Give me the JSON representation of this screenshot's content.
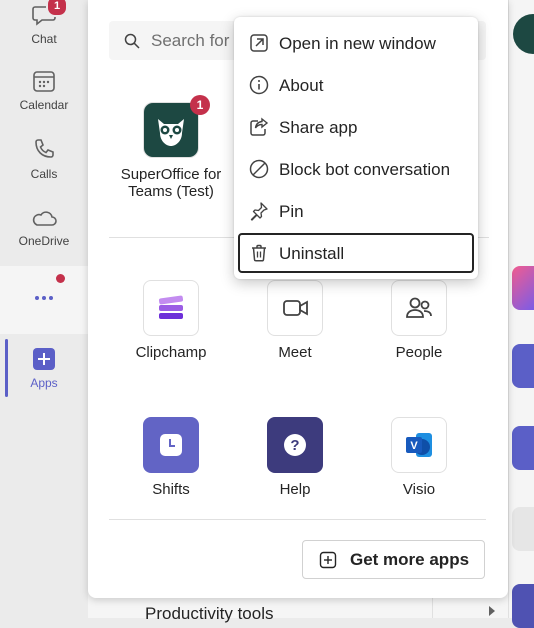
{
  "rail": {
    "items": [
      {
        "label": "Chat",
        "icon": "chat-icon",
        "badge": "1"
      },
      {
        "label": "Calendar",
        "icon": "calendar-icon"
      },
      {
        "label": "Calls",
        "icon": "calls-icon"
      },
      {
        "label": "OneDrive",
        "icon": "onedrive-icon"
      },
      {
        "label": "",
        "icon": "more-icon"
      },
      {
        "label": "Apps",
        "icon": "apps-icon"
      }
    ]
  },
  "search": {
    "placeholder": "Search for"
  },
  "pinned_app": {
    "name": "SuperOffice for Teams (Test)",
    "badge": "1",
    "icon": "superoffice-owl-icon"
  },
  "apps": [
    {
      "name": "Clipchamp",
      "icon": "clipchamp-icon"
    },
    {
      "name": "Meet",
      "icon": "meet-video-icon"
    },
    {
      "name": "People",
      "icon": "people-icon"
    },
    {
      "name": "Shifts",
      "icon": "shifts-clock-icon"
    },
    {
      "name": "Help",
      "icon": "help-question-icon"
    },
    {
      "name": "Visio",
      "icon": "visio-icon"
    }
  ],
  "get_more_apps": {
    "label": "Get more apps"
  },
  "context_menu": {
    "items": [
      {
        "label": "Open in new window",
        "icon": "open-window-icon"
      },
      {
        "label": "About",
        "icon": "info-icon"
      },
      {
        "label": "Share app",
        "icon": "share-icon"
      },
      {
        "label": "Block bot conversation",
        "icon": "block-icon"
      },
      {
        "label": "Pin",
        "icon": "pin-icon"
      },
      {
        "label": "Uninstall",
        "icon": "trash-icon",
        "focused": true
      }
    ]
  },
  "background": {
    "section_label": "Productivity tools"
  },
  "colors": {
    "accent": "#5b5fc7",
    "badge": "#c4314b",
    "owl_bg": "#1d4842",
    "help_bg": "#3d3b7d"
  }
}
